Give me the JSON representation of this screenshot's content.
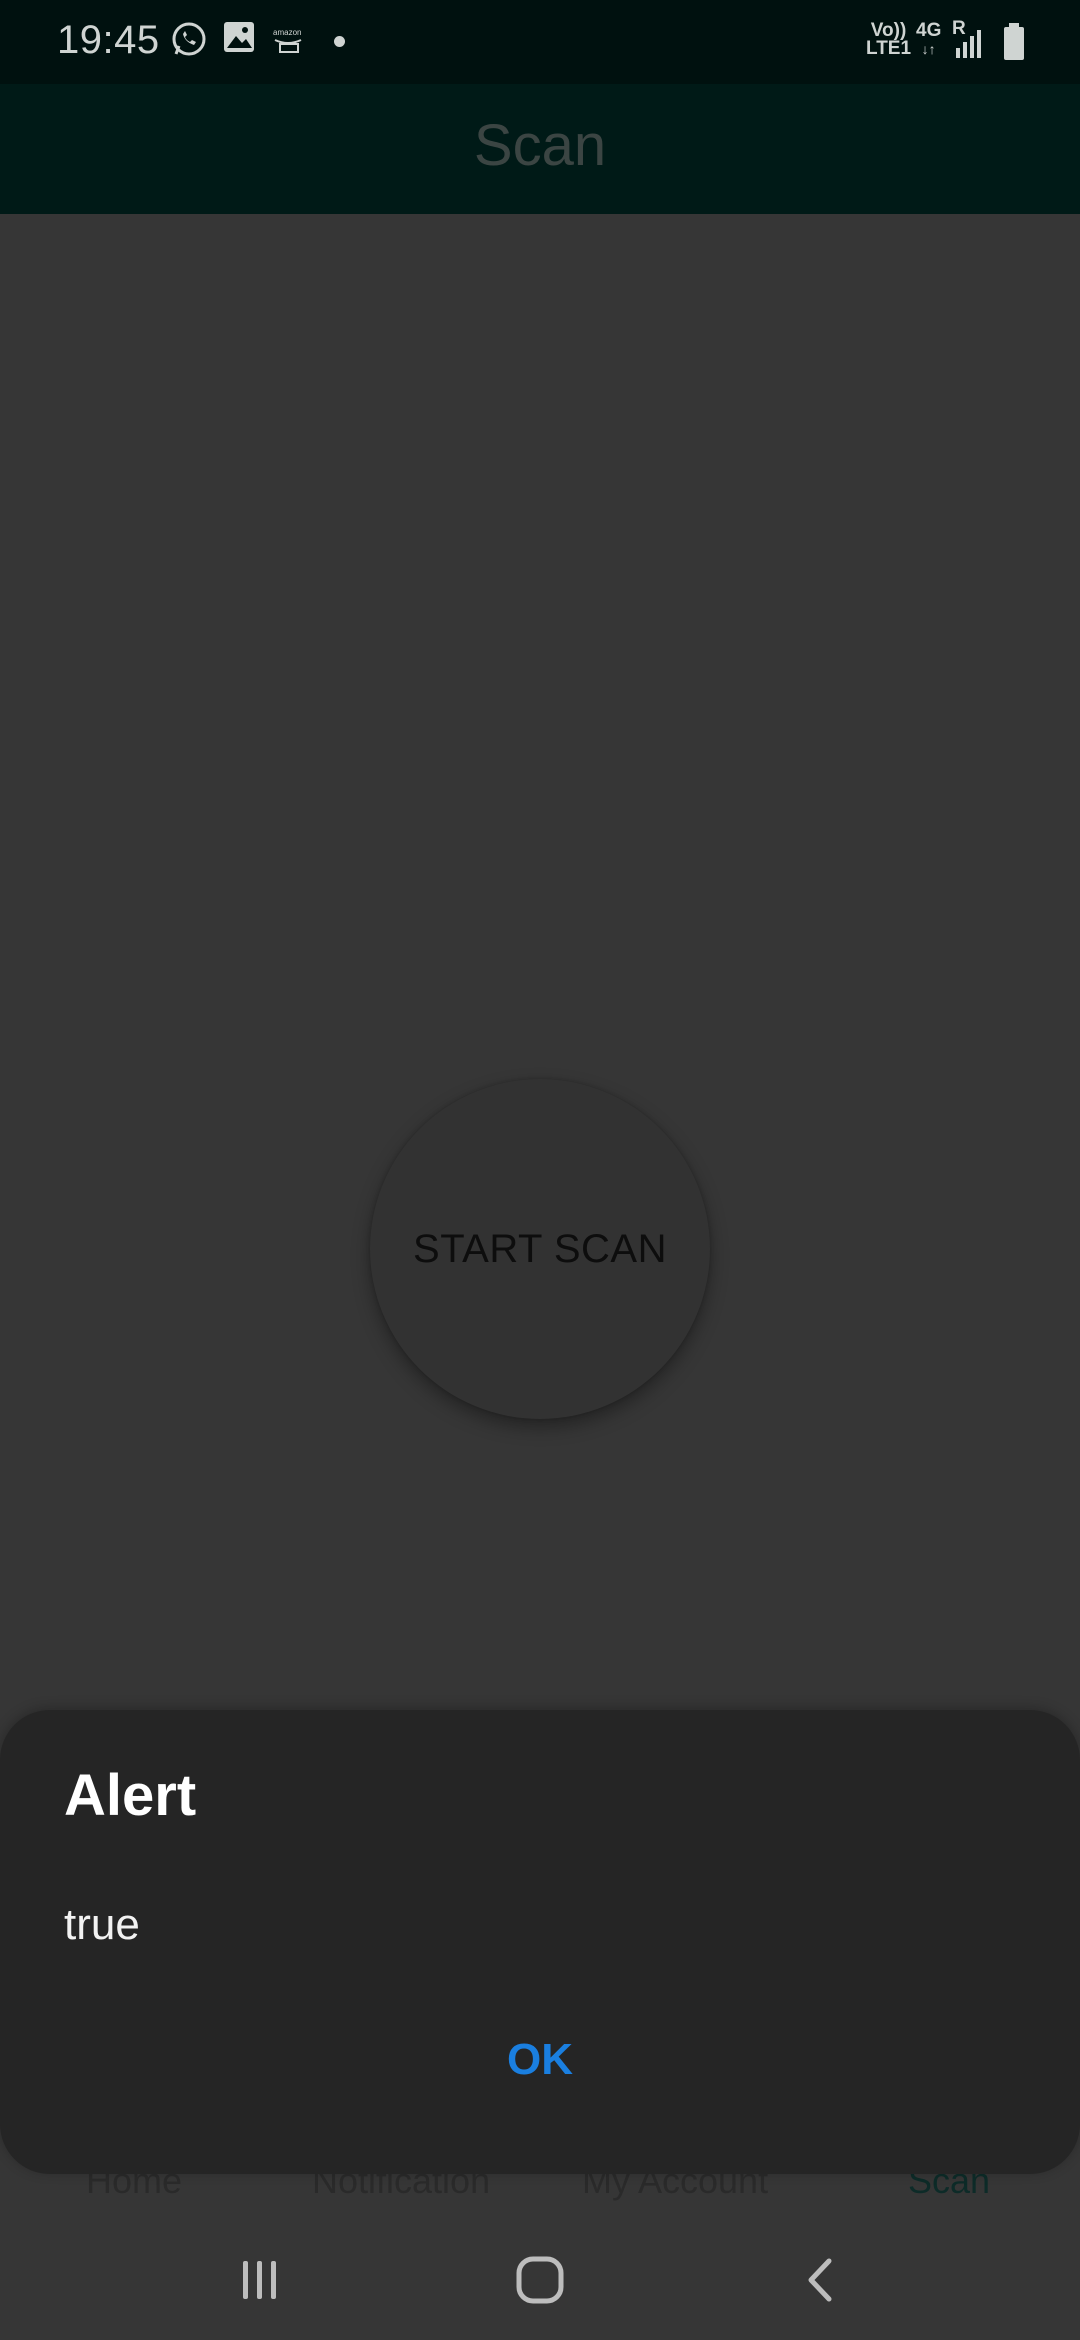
{
  "status_bar": {
    "time": "19:45",
    "icons": [
      "whatsapp-icon",
      "gallery-icon",
      "amazon-icon",
      "dot-icon"
    ],
    "network": {
      "volte_top": "Vo))",
      "volte_bottom": "LTE1",
      "data_type": "4G",
      "roaming": "R"
    }
  },
  "header": {
    "title": "Scan"
  },
  "main": {
    "scan_button_label": "START SCAN"
  },
  "tabs": [
    {
      "label": "Home"
    },
    {
      "label": "Notification"
    },
    {
      "label": "My Account"
    },
    {
      "label": "Scan",
      "active": true
    }
  ],
  "dialog": {
    "title": "Alert",
    "message": "true",
    "ok_label": "OK"
  },
  "colors": {
    "accent": "#1a7fe0",
    "header_bg": "#001A17",
    "dialog_bg": "#252525"
  },
  "nav_bar": {
    "buttons": [
      "recent-apps-icon",
      "home-icon",
      "back-icon"
    ]
  }
}
